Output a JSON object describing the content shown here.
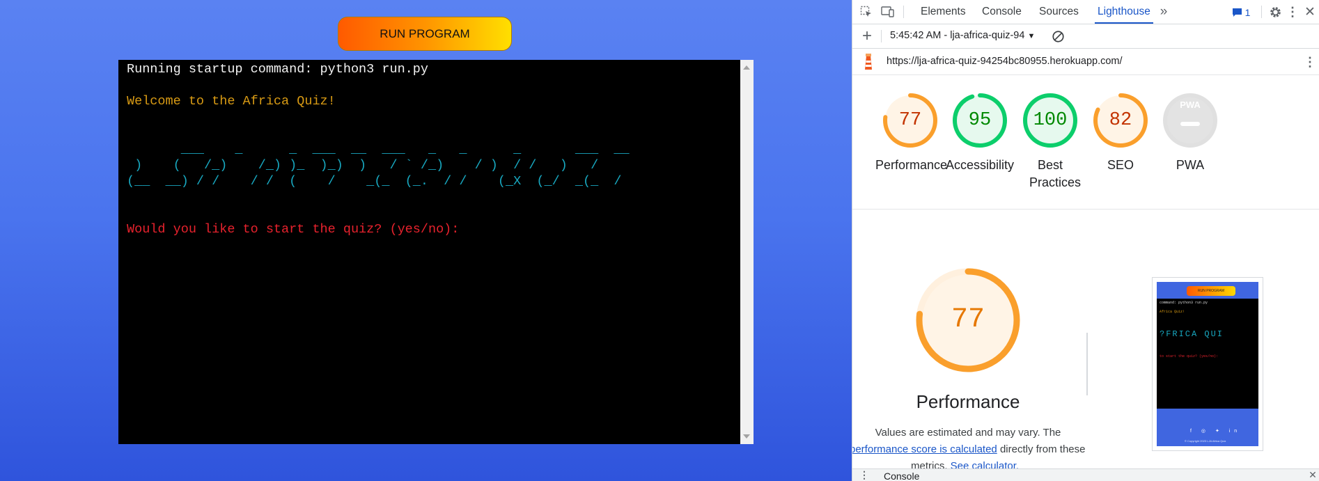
{
  "app": {
    "run_button_label": "RUN PROGRAM",
    "terminal": {
      "startup_line": "Running startup command: python3 run.py",
      "welcome_line": "Welcome to the Africa Quiz!",
      "ascii_art": [
        "       ___    _      _  ___  __  ___   _   _      _       ___  __",
        " )    (   /_)    /_) )_  )_)  )   / ` /_)    / )  / /   )   /",
        "(__  __) / /    / /  (    /    _(_  (_.  / /    (_X  (_/  _(_  /"
      ],
      "prompt_line": "Would you like to start the quiz? (yes/no):"
    }
  },
  "devtools": {
    "tabs": [
      "Elements",
      "Console",
      "Sources",
      "Lighthouse"
    ],
    "active_tab": "Lighthouse",
    "issues_count": "1",
    "report_selector": "5:45:42 AM - lja-africa-quiz-94",
    "url": "https://lja-africa-quiz-94254bc80955.herokuapp.com/",
    "scores": [
      {
        "label": "Performance",
        "value": 77,
        "status": "average",
        "color": "#fa9f2c",
        "bg": "#fff4e6",
        "text_color": "#c33300"
      },
      {
        "label": "Accessibility",
        "value": 95,
        "status": "pass",
        "color": "#0cce6b",
        "bg": "#e6f9ee",
        "text_color": "#008800"
      },
      {
        "label": "Best Practices",
        "value": 100,
        "status": "pass",
        "color": "#0cce6b",
        "bg": "#e6f9ee",
        "text_color": "#008800"
      },
      {
        "label": "SEO",
        "value": 82,
        "status": "average",
        "color": "#fa9f2c",
        "bg": "#fff4e6",
        "text_color": "#c33300"
      },
      {
        "label": "PWA",
        "value": null,
        "status": "na",
        "color": "#e0e0e0",
        "bg": "#e3e3e3",
        "text_color": "#ffffff"
      }
    ],
    "pwa_badge": "PWA",
    "performance_detail": {
      "score": "77",
      "score_fraction": 0.77,
      "title": "Performance",
      "note_start": "Values are estimated and may vary. The",
      "note_link": "performance score is calculated",
      "note_end": "directly from these",
      "note_line3_start": "metrics.",
      "note_line3_link": "See calculator."
    },
    "thumbnail": {
      "button": "RUN PROGRAM",
      "line1": "command: python3 run.py",
      "line2": "Africa Quiz!",
      "line3": "?FRICA QUI",
      "line4": "to start the quiz? (yes/no):",
      "copyright": "© Copyright 2023 LJA Africa Quiz"
    },
    "drawer_tab": "Console",
    "colors": {
      "accent": "#1a56c8",
      "average": "#fa9f2c",
      "pass": "#0cce6b"
    }
  }
}
